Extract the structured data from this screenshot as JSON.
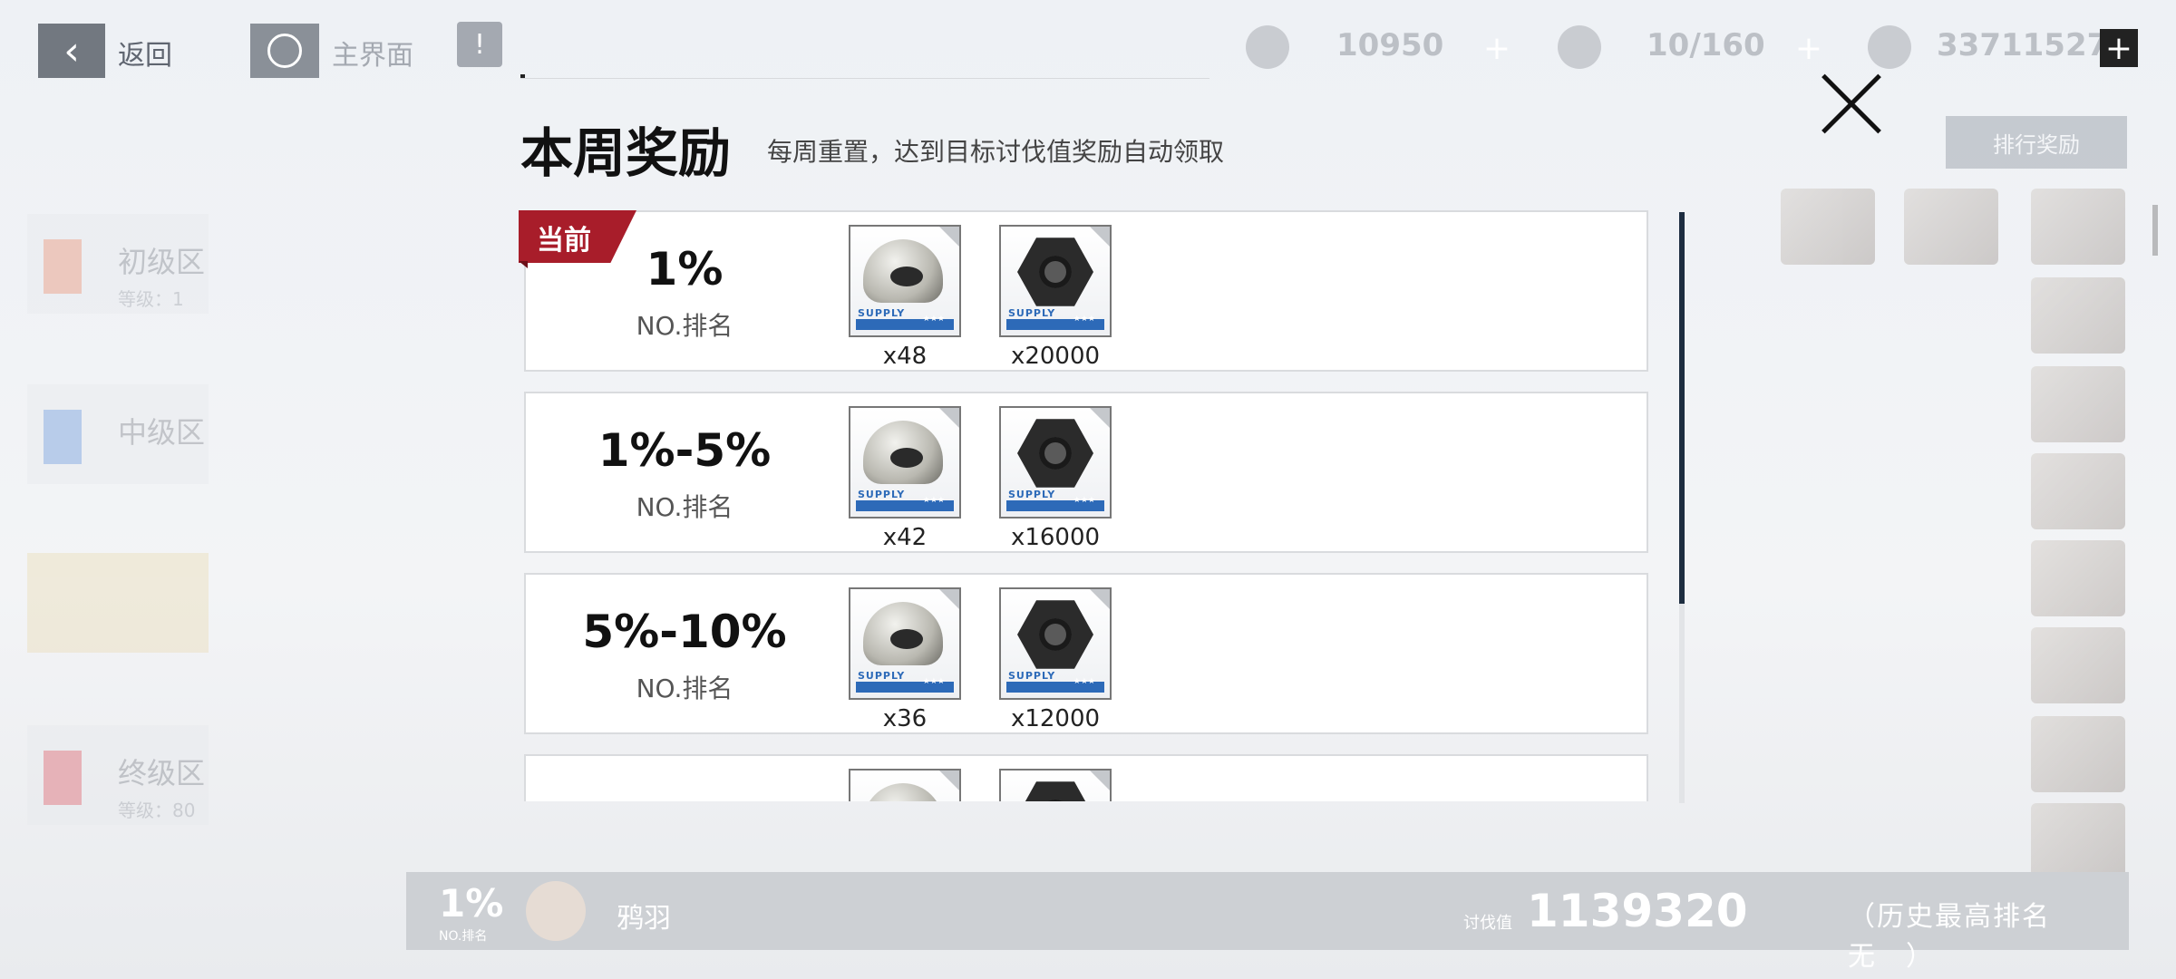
{
  "topbar": {
    "back_label": "返回",
    "home_label": "主界面",
    "resources": [
      {
        "icon": "ticket-icon",
        "value": "10950"
      },
      {
        "icon": "syringe-icon",
        "value": "10/160"
      },
      {
        "icon": "coin-icon",
        "value": "33711527"
      }
    ]
  },
  "background": {
    "tabs": [
      {
        "label": "初级区",
        "sub": "等级：1"
      },
      {
        "label": "中级区",
        "sub": ""
      },
      {
        "label": "",
        "sub": ""
      },
      {
        "label": "终级区",
        "sub": "等级：80"
      }
    ],
    "rank_reward_button": "排行奖励"
  },
  "modal": {
    "title": "本周奖励",
    "subtitle": "每周重置，达到目标讨伐值奖励自动领取",
    "current_badge": "当前",
    "rows": [
      {
        "tier": "1%",
        "tier_sub": "NO.排名",
        "current": true,
        "rewards": [
          {
            "icon": "helmet-icon",
            "qty": "x48"
          },
          {
            "icon": "nut-icon",
            "qty": "x20000"
          }
        ]
      },
      {
        "tier": "1%-5%",
        "tier_sub": "NO.排名",
        "current": false,
        "rewards": [
          {
            "icon": "helmet-icon",
            "qty": "x42"
          },
          {
            "icon": "nut-icon",
            "qty": "x16000"
          }
        ]
      },
      {
        "tier": "5%-10%",
        "tier_sub": "NO.排名",
        "current": false,
        "rewards": [
          {
            "icon": "helmet-icon",
            "qty": "x36"
          },
          {
            "icon": "nut-icon",
            "qty": "x12000"
          }
        ]
      }
    ],
    "supply_label": "SUPPLY",
    "stars": "★★★"
  },
  "bottombar": {
    "rank_pct": "1%",
    "rank_pct_label": "NO.排名",
    "player_name": "鸦羽",
    "score_label": "讨伐值",
    "score": "1139320",
    "history_rank": "（历史最高排名　无　）"
  }
}
